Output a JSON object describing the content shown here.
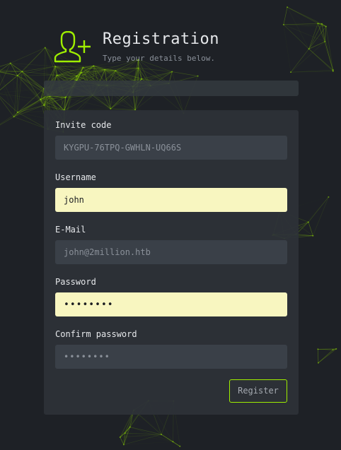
{
  "header": {
    "title": "Registration",
    "subtitle": "Type your details below.",
    "icon": "user-plus-icon"
  },
  "colors": {
    "accent": "#9fef00",
    "background": "#1e2126",
    "card": "#2d3238",
    "autofill": "#f8f6c0"
  },
  "form": {
    "invite_code": {
      "label": "Invite code",
      "value": "KYGPU-76TPQ-GWHLN-UQ66S"
    },
    "username": {
      "label": "Username",
      "value": "john"
    },
    "email": {
      "label": "E-Mail",
      "placeholder": "john@2million.htb"
    },
    "password": {
      "label": "Password",
      "masked_value": "••••••••"
    },
    "confirm_password": {
      "label": "Confirm password",
      "masked_placeholder": "••••••••"
    },
    "submit_label": "Register"
  }
}
